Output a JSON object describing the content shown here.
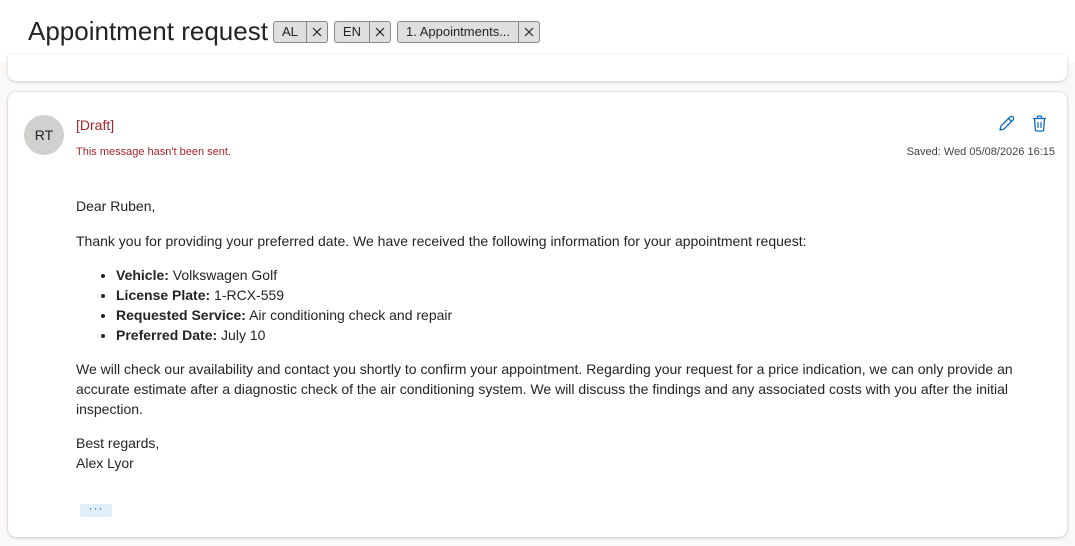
{
  "header": {
    "subject": "Appointment request",
    "tags": [
      {
        "label": "AL"
      },
      {
        "label": "EN"
      },
      {
        "label": "1. Appointments..."
      }
    ]
  },
  "message": {
    "avatar_initials": "RT",
    "status_label": "[Draft]",
    "status_note": "This message hasn't been sent.",
    "saved_text": "Saved: Wed 05/08/2026 16:15",
    "icons": {
      "edit": "pencil-icon",
      "delete": "trash-icon"
    },
    "colors": {
      "draft_red": "#a4262c",
      "accent_blue": "#0f6cbd",
      "avatar_bg": "#d2d0ce"
    },
    "body": {
      "greeting": "Dear Ruben,",
      "intro": "Thank you for providing your preferred date. We have received the following information for your appointment request:",
      "details": [
        {
          "label": "Vehicle:",
          "value": " Volkswagen Golf"
        },
        {
          "label": "License Plate:",
          "value": " 1-RCX-559"
        },
        {
          "label": "Requested Service:",
          "value": " Air conditioning check and repair"
        },
        {
          "label": "Preferred Date:",
          "value": " July 10"
        }
      ],
      "availability": "We will check our availability and contact you shortly to confirm your appointment. Regarding your request for a price indication, we can only provide an accurate estimate after a diagnostic check of the air conditioning system. We will discuss the findings and any associated costs with you after the initial inspection.",
      "closing": "Best regards,",
      "signature": "Alex Lyor"
    },
    "expand_label": "···"
  }
}
